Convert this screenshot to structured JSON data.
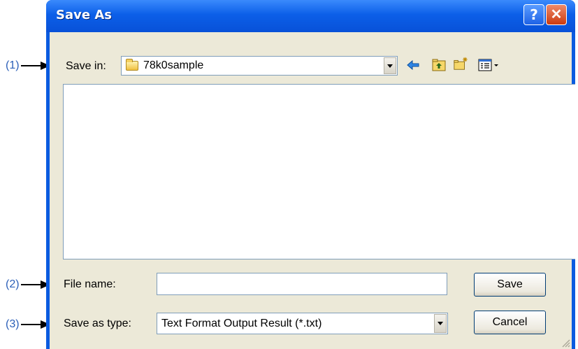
{
  "callouts": [
    "(1)",
    "(2)",
    "(3)"
  ],
  "window": {
    "title": "Save As",
    "help_glyph": "?",
    "close_glyph": "✕"
  },
  "save_in": {
    "label": "Save in:",
    "value": "78k0sample",
    "folder_icon": "folder-icon"
  },
  "toolbar_icons": [
    "back-arrow-icon",
    "up-folder-icon",
    "new-folder-icon",
    "view-menu-icon"
  ],
  "file_name": {
    "label": "File name:",
    "value": ""
  },
  "save_as_type": {
    "label": "Save as type:",
    "value": "Text Format Output Result (*.txt)"
  },
  "buttons": {
    "save": "Save",
    "cancel": "Cancel"
  },
  "colors": {
    "callout": "#2b5fb8",
    "titlebar": "#0c5fe8",
    "client_bg": "#ece9d8",
    "close_button": "#cc3b10",
    "back_arrow": "#2f86e6",
    "folder": "#f0c040"
  }
}
